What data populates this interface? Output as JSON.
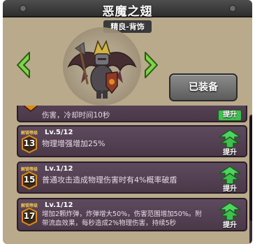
{
  "item": {
    "title": "恶魔之翅",
    "subtitle": "精良-背饰",
    "equip_button": "已装备"
  },
  "colors": {
    "panel": "#b9aa8c",
    "row": "#4f3c4f",
    "upgrade_green": "#3fbf4f",
    "badge_orange": "#e08a1a"
  },
  "skills": [
    {
      "partial": true,
      "badge_caption": "",
      "badge_number": "",
      "level": "",
      "description": "伤害，冷却时间10秒",
      "upgrade_label": "提升"
    },
    {
      "partial": false,
      "badge_caption": "解锁等级",
      "badge_number": "13",
      "level": "Lv.5/12",
      "description": "物理增强增加25%",
      "upgrade_label": "提升"
    },
    {
      "partial": false,
      "badge_caption": "解锁等级",
      "badge_number": "15",
      "level": "Lv.1/12",
      "description": "普通攻击造成物理伤害时有4%概率破盾",
      "upgrade_label": "提升"
    },
    {
      "partial": false,
      "badge_caption": "解锁等级",
      "badge_number": "17",
      "level": "Lv.1/12",
      "description": "增加2颗炸弹，炸弹增大50%，伤害范围增加50%。附带流血效果，每秒造成2%物理伤害，持续5秒",
      "upgrade_label": "提升"
    }
  ]
}
